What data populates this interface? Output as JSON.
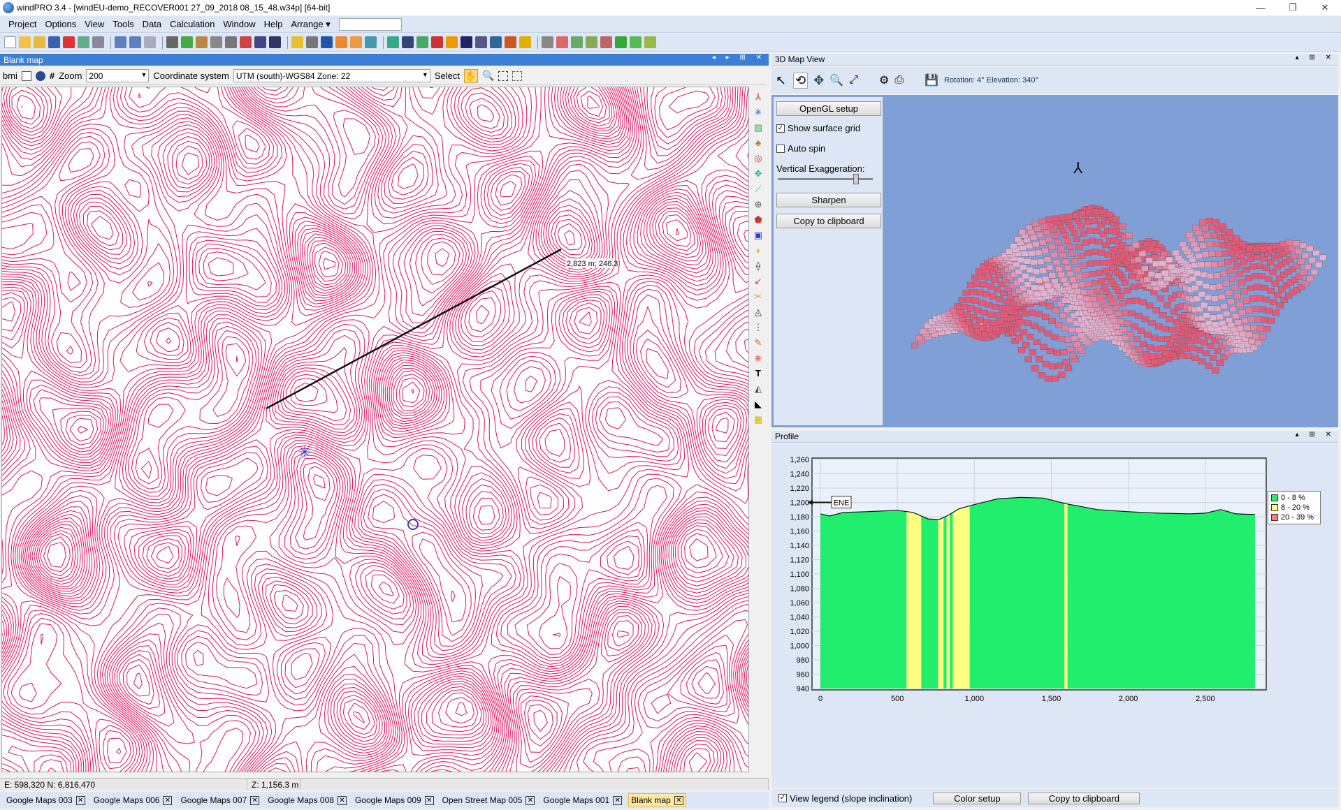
{
  "window": {
    "title": "windPRO 3.4 - [windEU-demo_RECOVER001 27_09_2018 08_15_48.w34p] [64-bit]",
    "controls": [
      "—",
      "❐",
      "✕"
    ]
  },
  "menu": {
    "items": [
      "Project",
      "Options",
      "View",
      "Tools",
      "Data",
      "Calculation",
      "Window",
      "Help"
    ],
    "arrange_label": "Arrange"
  },
  "blank_map": {
    "panel_title": "Blank map",
    "bmi_label": "bmi",
    "zoom_label": "Zoom",
    "zoom_value": "200",
    "coord_label": "Coordinate system",
    "coord_value": "UTM (south)-WGS84 Zone: 22",
    "select_label": "Select",
    "measure_label": "2,823 m; 246.3"
  },
  "status": {
    "easting_northing": "E: 598,320  N: 6,816,470",
    "z_value": "Z: 1,156.3 m"
  },
  "tabs": [
    {
      "label": "Google Maps 003",
      "active": false
    },
    {
      "label": "Google Maps 006",
      "active": false
    },
    {
      "label": "Google Maps 007",
      "active": false
    },
    {
      "label": "Google Maps 008",
      "active": false
    },
    {
      "label": "Google Maps 009",
      "active": false
    },
    {
      "label": "Open Street Map 005",
      "active": false
    },
    {
      "label": "Google Maps 001",
      "active": false
    },
    {
      "label": "Blank map",
      "active": true
    }
  ],
  "map3d": {
    "panel_title": "3D Map View",
    "rotation_text": "Rotation: 4° Elevation: 340°",
    "opengl_button": "OpenGL setup",
    "show_grid_label": "Show surface grid",
    "show_grid_checked": true,
    "auto_spin_label": "Auto spin",
    "auto_spin_checked": false,
    "vertical_exag_label": "Vertical Exaggeration:",
    "vertical_exag_level": 0.8,
    "sharpen_button": "Sharpen",
    "copy_button": "Copy to clipboard",
    "background_color": "#7f9fd6"
  },
  "profile": {
    "panel_title": "Profile",
    "view_legend_label": "View legend (slope inclination)",
    "view_legend_checked": true,
    "color_setup_button": "Color setup",
    "copy_button": "Copy to clipboard",
    "direction_label": "ENE"
  },
  "chart_data": {
    "type": "area",
    "title": "",
    "xlabel": "",
    "ylabel": "",
    "xlim": [
      0,
      2823
    ],
    "ylim": [
      940,
      1260
    ],
    "x_ticks": [
      0,
      500,
      1000,
      1500,
      2000,
      2500
    ],
    "x_tick_labels": [
      "0",
      "500",
      "1,000",
      "1,500",
      "2,000",
      "2,500"
    ],
    "y_ticks": [
      940,
      960,
      980,
      1000,
      1020,
      1040,
      1060,
      1080,
      1100,
      1120,
      1140,
      1160,
      1180,
      1200,
      1220,
      1240,
      1260
    ],
    "y_tick_labels": [
      "940",
      "960",
      "980",
      "1,000",
      "1,020",
      "1,040",
      "1,060",
      "1,080",
      "1,100",
      "1,120",
      "1,140",
      "1,160",
      "1,180",
      "1,200",
      "1,220",
      "1,240",
      "1,260"
    ],
    "grid": true,
    "legend_position": "right",
    "profile": {
      "x": [
        0,
        60,
        150,
        300,
        500,
        600,
        700,
        770,
        830,
        900,
        1000,
        1150,
        1300,
        1450,
        1600,
        1800,
        2000,
        2200,
        2400,
        2500,
        2600,
        2700,
        2823
      ],
      "y": [
        1184,
        1181,
        1186,
        1187,
        1189,
        1186,
        1177,
        1176,
        1182,
        1191,
        1197,
        1205,
        1207,
        1206,
        1198,
        1190,
        1187,
        1185,
        1184,
        1185,
        1190,
        1184,
        1183
      ]
    },
    "slope_classes": [
      {
        "name": "0 - 8 %",
        "color": "#22ee6e"
      },
      {
        "name": "8 - 20 %",
        "color": "#ffff80"
      },
      {
        "name": "20 - 39 %",
        "color": "#ff7a7a"
      }
    ],
    "slope_segments": [
      {
        "from": 0,
        "to": 560,
        "class": 0
      },
      {
        "from": 560,
        "to": 655,
        "class": 1
      },
      {
        "from": 655,
        "to": 765,
        "class": 0
      },
      {
        "from": 765,
        "to": 800,
        "class": 1
      },
      {
        "from": 800,
        "to": 820,
        "class": 0
      },
      {
        "from": 820,
        "to": 840,
        "class": 1
      },
      {
        "from": 840,
        "to": 860,
        "class": 0
      },
      {
        "from": 860,
        "to": 970,
        "class": 1
      },
      {
        "from": 970,
        "to": 1585,
        "class": 0
      },
      {
        "from": 1585,
        "to": 1605,
        "class": 1
      },
      {
        "from": 1605,
        "to": 2823,
        "class": 0
      }
    ],
    "direction_marker_y": 1200
  }
}
